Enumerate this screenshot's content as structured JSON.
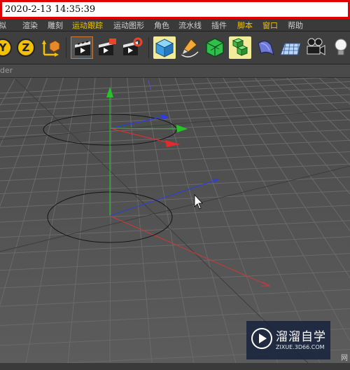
{
  "timestamp": "2020-2-13 14:35:39",
  "menubar": {
    "items": [
      "模拟",
      "渲染",
      "雕刻",
      "运动跟踪",
      "运动图形",
      "角色",
      "流水线",
      "插件",
      "脚本",
      "窗口",
      "帮助"
    ],
    "highlighted": [
      "运动跟踪",
      "脚本",
      "窗口"
    ]
  },
  "toolbar": {
    "axis_y_label": "Y",
    "axis_z_label": "Z",
    "icons": [
      "lock-axis-y-icon",
      "lock-axis-z-icon",
      "coordinate-system-icon",
      "render-view-icon",
      "render-picture-viewer-icon",
      "render-settings-icon",
      "cube-primitive-icon",
      "pen-spline-icon",
      "subdivision-surface-icon",
      "array-generator-icon",
      "deformer-bend-icon",
      "floor-plane-icon",
      "camera-icon",
      "light-bulb-icon"
    ]
  },
  "panel": {
    "title": "der"
  },
  "viewport": {
    "edge_label": "网"
  },
  "watermark": {
    "brand": "溜溜自学",
    "url": "ZIXUE.3D66.COM"
  },
  "colors": {
    "accent_yellow": "#f2c200",
    "axis_x": "#e22a2a",
    "axis_y": "#27c427",
    "axis_z": "#2a3ee2",
    "stamp_border": "#e00000",
    "watermark_bg": "#14203c"
  }
}
